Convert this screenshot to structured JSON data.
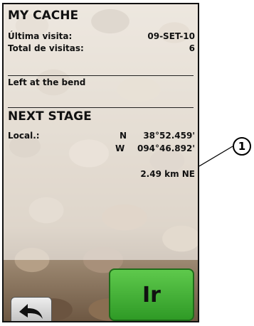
{
  "cache": {
    "title": "MY CACHE",
    "last_visit_label": "Última visita:",
    "last_visit_value": "09-SET-10",
    "total_visits_label": "Total de visitas:",
    "total_visits_value": "6",
    "note": "Left at the bend"
  },
  "next_stage": {
    "title": "NEXT STAGE",
    "location_label": "Local.:",
    "lat_hemisphere": "N",
    "lat_value": "38°52.459'",
    "lon_hemisphere": "W",
    "lon_value": "094°46.892'",
    "distance": "2.49 km NE"
  },
  "buttons": {
    "go_label": "Ir",
    "back_icon": "back-arrow-icon"
  },
  "callout": {
    "number": "1"
  }
}
